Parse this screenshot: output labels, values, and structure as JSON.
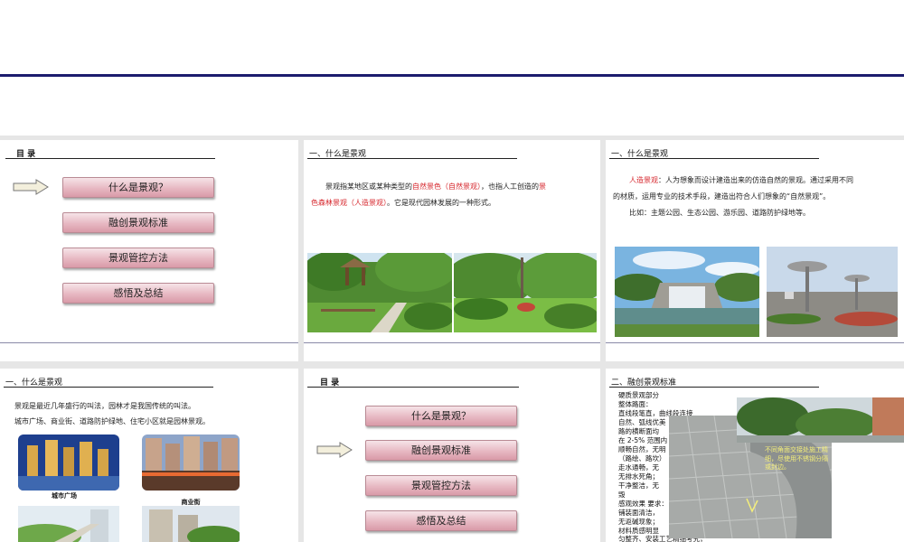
{
  "slides": {
    "toc1": {
      "title": "目  录",
      "items": [
        {
          "label": "什么是景观？"
        },
        {
          "label": "融创景观标准"
        },
        {
          "label": "景观管控方法"
        },
        {
          "label": "感悟及总结"
        }
      ]
    },
    "what1": {
      "title": "一、什么是景观",
      "p1": "景观指某地区或某种类型的",
      "p1_red": "自然景色（自然景观）",
      "p1_after": "，也指人工创造的",
      "p1_red2a": "景",
      "p1_red2b": "色森林景观（人造景观）",
      "p2": "。它是现代园林发展的一种形式。"
    },
    "what2": {
      "title": "一、什么是景观",
      "term": "人造景观",
      "def": "：人为想象而设计建造出来的仿造自然的景观。通过采用不同",
      "def2": "的材质，运用专业的技术手段，建造出符合人们想象的“自然景观”。",
      "example": "比如：主题公园、生态公园、游乐园、道路防护绿地等。"
    },
    "what3": {
      "title": "一、什么是景观",
      "line1": "景观是最近几年盛行的叫法，园林才是我国传统的叫法。",
      "line2": "城市广场、商业街、道路防护绿地、住宅小区就是园林景观。",
      "captions": [
        "城市广场",
        "商业街"
      ]
    },
    "toc2": {
      "title": "目  录",
      "items": [
        {
          "label": "什么是景观？"
        },
        {
          "label": "融创景观标准"
        },
        {
          "label": "景观管控方法"
        },
        {
          "label": "感悟及总结"
        }
      ]
    },
    "standard": {
      "title": "二、融创景观标准",
      "lines": [
        "硬质景观部分",
        "整体路面：",
        "    直线段笔直，曲线段连接",
        "自然、弧线优美",
        "    路的横断面均",
        "在 2-5% 范围内",
        "顺畅自然，无明",
        "（路绘、路坎）",
        "    走水通畅，无",
        "无排水死角；",
        "    干净整洁，无",
        "毁",
        "感观效果 要求：",
        "    铺装面清洁，",
        "无返碱现象；",
        "    材料质感明显",
        "匀整齐、安装工艺精细考究；"
      ],
      "overlay": "不同角面交接处施工精细，尽使用不锈钢分隔或封边。"
    }
  },
  "colors": {
    "accent_navy": "#1c1c6e",
    "emphasis_red": "#d6262c",
    "button_pink": "#e7b8c2"
  }
}
